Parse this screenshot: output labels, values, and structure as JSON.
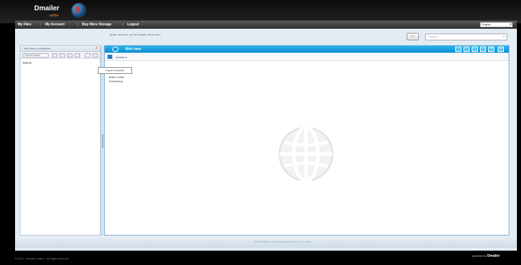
{
  "brand": {
    "name": "Dmailer",
    "tagline": "online"
  },
  "nav": {
    "items": [
      "My Files",
      "My Account",
      "Buy More Storage",
      "Logout"
    ],
    "language": "English"
  },
  "toolbar": {
    "headline": "Better services, try the Dmailer Web view !",
    "search_placeholder": "Search"
  },
  "left_panel": {
    "header": "Tree view & navigation",
    "combo_value": "Files/Folders",
    "label": "Search"
  },
  "main_panel": {
    "title": "Web view",
    "subbar_label": "Actions",
    "context_menu": [
      "Import contacts",
      "Make a Web",
      "Scheduling"
    ]
  },
  "footer": {
    "center_text": "Online backup and storage powered by",
    "center_link": "Dmailer",
    "copyright": "© 2011 - Dmailer Online - All rights reserved",
    "powered_prefix": "powered by",
    "powered_brand": "Dmailer"
  }
}
